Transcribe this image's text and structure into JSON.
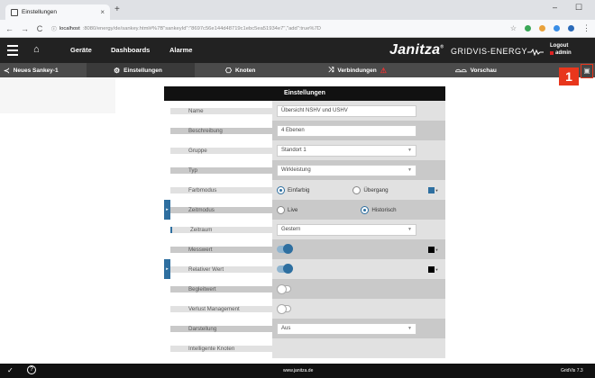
{
  "browser": {
    "tab_title": "Einstellungen",
    "tab_close": "×",
    "new_tab": "+",
    "url_host": "localhost",
    "url_path": ":8080/energy/de/sankey.html#%7B\"sankeyId\":\"8697c56e144d48719c1ebc5ea51934e7\",\"add\":true%7D",
    "window_controls": [
      "–",
      "☐"
    ]
  },
  "header": {
    "nav": [
      "Geräte",
      "Dashboards",
      "Alarme"
    ],
    "brand": "Janitza",
    "brand_mark": "®",
    "product": "GRIDVIS-ENERGY",
    "logout": "Logout",
    "user": "admin"
  },
  "toolbar": {
    "new_sankey": "Neues Sankey-1",
    "tabs": [
      "Einstellungen",
      "Knoten",
      "Verbindungen",
      "Vorschau"
    ],
    "badge": "1"
  },
  "panel": {
    "title": "Einstellungen",
    "rows": {
      "name": {
        "label": "Name",
        "value": "Übersicht NSHV und USHV"
      },
      "beschreibung": {
        "label": "Beschreibung",
        "value": "4 Ebenen"
      },
      "gruppe": {
        "label": "Gruppe",
        "value": "Standort 1"
      },
      "typ": {
        "label": "Typ",
        "value": "Wirkleistung"
      },
      "farbmodus": {
        "label": "Farbmodus",
        "option1": "Einfarbig",
        "option2": "Übergang"
      },
      "zeitmodus": {
        "label": "Zeitmodus",
        "option1": "Live",
        "option2": "Historisch"
      },
      "zeitraum": {
        "label": "Zeitraum",
        "value": "Gestern"
      },
      "messwert": {
        "label": "Messwert"
      },
      "relativer": {
        "label": "Relativer Wert"
      },
      "begleitwert": {
        "label": "Begleitwert"
      },
      "verlust": {
        "label": "Verlust Management"
      },
      "darstellung": {
        "label": "Darstellung",
        "value": "Aus"
      },
      "intelligente": {
        "label": "Intelligente Knoten"
      }
    }
  },
  "footer": {
    "center": "www.janitza.de",
    "version": "GridVis 7.3"
  },
  "colors": {
    "accent_blue": "#2e6fa0",
    "badge_red": "#e8361c",
    "header_bg": "#222222",
    "toolbar_bg": "#4b4b4b"
  }
}
